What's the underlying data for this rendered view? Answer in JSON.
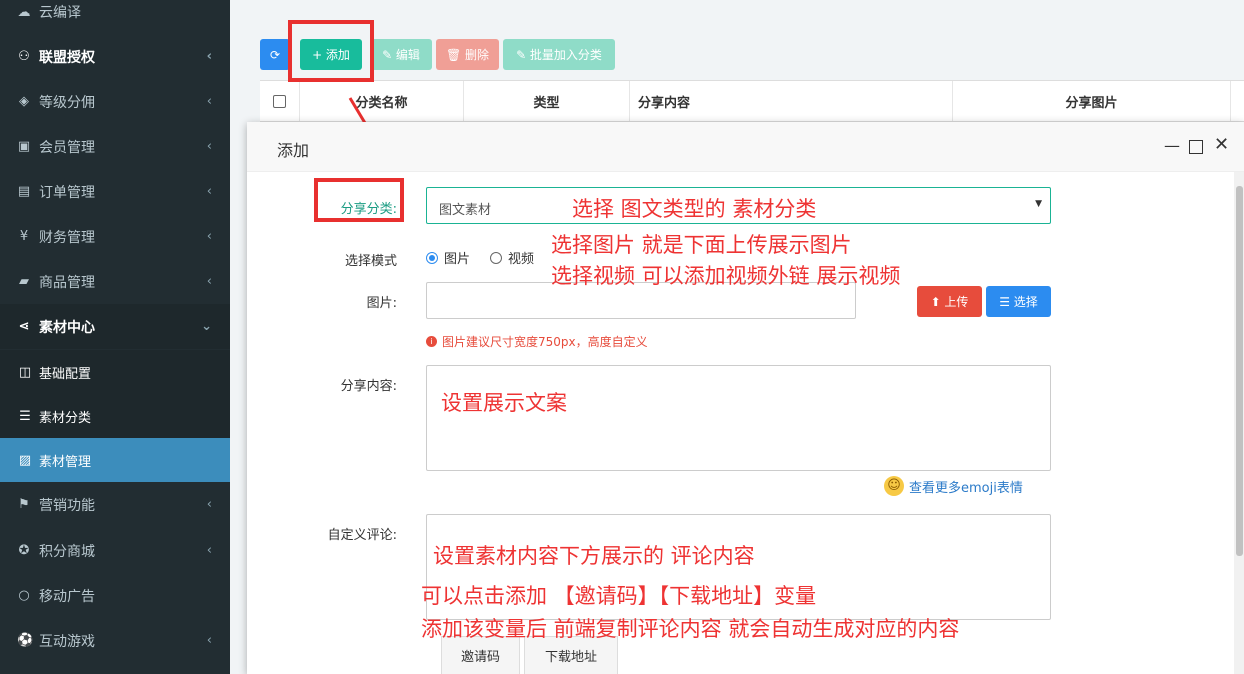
{
  "sidebar": {
    "items": [
      {
        "label": "云编译",
        "icon": "cloud-icon",
        "glyph": "☁"
      },
      {
        "label": "联盟授权",
        "icon": "users-icon",
        "glyph": "⚇",
        "arrow": "‹"
      },
      {
        "label": "等级分佣",
        "icon": "diamond-icon",
        "glyph": "◈",
        "arrow": "‹"
      },
      {
        "label": "会员管理",
        "icon": "member-card-icon",
        "glyph": "▣",
        "arrow": "‹"
      },
      {
        "label": "订单管理",
        "icon": "order-icon",
        "glyph": "▤",
        "arrow": "‹"
      },
      {
        "label": "财务管理",
        "icon": "yen-icon",
        "glyph": "¥",
        "arrow": "‹"
      },
      {
        "label": "商品管理",
        "icon": "briefcase-icon",
        "glyph": "▰",
        "arrow": "‹"
      },
      {
        "label": "素材中心",
        "icon": "share-icon",
        "glyph": "⋖",
        "arrow": "⌄"
      }
    ],
    "sub_items": [
      {
        "label": "基础配置",
        "icon": "columns-icon",
        "glyph": "◫"
      },
      {
        "label": "素材分类",
        "icon": "list-icon",
        "glyph": "☰"
      },
      {
        "label": "素材管理",
        "icon": "image-icon",
        "glyph": "▨"
      }
    ],
    "items2": [
      {
        "label": "营销功能",
        "icon": "gift-icon",
        "glyph": "⚑",
        "arrow": "‹"
      },
      {
        "label": "积分商城",
        "icon": "coin-icon",
        "glyph": "✪",
        "arrow": "‹"
      },
      {
        "label": "移动广告",
        "icon": "circle-icon",
        "glyph": "○"
      },
      {
        "label": "互动游戏",
        "icon": "football-icon",
        "glyph": "⚽",
        "arrow": "‹"
      }
    ]
  },
  "toolbar": {
    "refresh_glyph": "⟳",
    "add_label": "+ 添加",
    "edit_label": "✎ 编辑",
    "delete_label": "🗑 删除",
    "batch_label": "✎ 批量加入分类"
  },
  "table": {
    "headers": [
      "分类名称",
      "类型",
      "分享内容",
      "分享图片"
    ]
  },
  "modal": {
    "title": "添加",
    "category_label": "分享分类:",
    "category_value": "图文素材",
    "mode_label": "选择模式",
    "mode_image": "图片",
    "mode_video": "视频",
    "image_label": "图片:",
    "upload_label": "⬆ 上传",
    "select_label": "☰ 选择",
    "image_hint": "图片建议尺寸宽度750px，高度自定义",
    "content_label": "分享内容:",
    "emoji_link": "查看更多emoji表情",
    "comment_label": "自定义评论:",
    "tab_invite": "邀请码",
    "tab_download": "下载地址"
  },
  "annotations": {
    "a1": "选择 图文类型的 素材分类",
    "a2": "选择图片 就是下面上传展示图片",
    "a3": "选择视频 可以添加视频外链 展示视频",
    "a4": "设置展示文案",
    "a5": "设置素材内容下方展示的  评论内容",
    "a6": "可以点击添加   【邀请码】【下载地址】变量",
    "a7": "添加该变量后  前端复制评论内容 就会自动生成对应的内容"
  },
  "colors": {
    "sidebar_bg": "#222d32",
    "active_blue": "#3c8dbc",
    "add_green": "#18bc9c",
    "delete_red": "#e74c3c",
    "annotation_red": "#e8302f"
  }
}
